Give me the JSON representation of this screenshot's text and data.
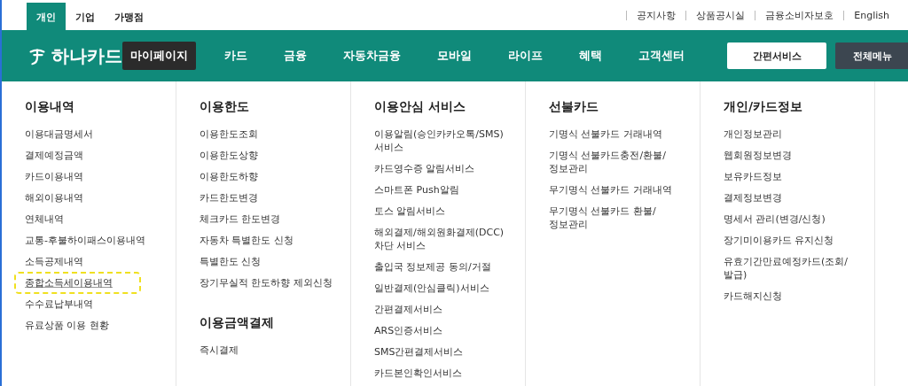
{
  "top_tabs": [
    {
      "label": "개인",
      "selected": true
    },
    {
      "label": "기업",
      "selected": false
    },
    {
      "label": "가맹점",
      "selected": false
    }
  ],
  "util_links": [
    "공지사항",
    "상품공시실",
    "금융소비자보호",
    "English"
  ],
  "logo": {
    "text": "하나카드"
  },
  "nav": [
    {
      "label": "마이페이지",
      "selected": true
    },
    {
      "label": "카드",
      "selected": false
    },
    {
      "label": "금융",
      "selected": false
    },
    {
      "label": "자동차금융",
      "selected": false
    },
    {
      "label": "모바일",
      "selected": false
    },
    {
      "label": "라이프",
      "selected": false
    },
    {
      "label": "혜택",
      "selected": false
    },
    {
      "label": "고객센터",
      "selected": false
    }
  ],
  "nav_buttons": [
    {
      "label": "간편서비스",
      "kind": "light"
    },
    {
      "label": "전체메뉴",
      "kind": "dark"
    }
  ],
  "columns": [
    {
      "sections": [
        {
          "title": "이용내역",
          "items": [
            {
              "label": "이용대금명세서",
              "highlighted": false
            },
            {
              "label": "결제예정금액",
              "highlighted": false
            },
            {
              "label": "카드이용내역",
              "highlighted": false
            },
            {
              "label": "해외이용내역",
              "highlighted": false
            },
            {
              "label": "연체내역",
              "highlighted": false
            },
            {
              "label": "교통-후불하이패스이용내역",
              "highlighted": false
            },
            {
              "label": "소득공제내역",
              "highlighted": false
            },
            {
              "label": "종합소득세이용내역",
              "highlighted": true
            },
            {
              "label": "수수료납부내역",
              "highlighted": false
            },
            {
              "label": "유료상품 이용 현황",
              "highlighted": false
            }
          ]
        }
      ]
    },
    {
      "sections": [
        {
          "title": "이용한도",
          "items": [
            {
              "label": "이용한도조회",
              "highlighted": false
            },
            {
              "label": "이용한도상향",
              "highlighted": false
            },
            {
              "label": "이용한도하향",
              "highlighted": false
            },
            {
              "label": "카드한도변경",
              "highlighted": false
            },
            {
              "label": "체크카드 한도변경",
              "highlighted": false
            },
            {
              "label": "자동차 특별한도 신청",
              "highlighted": false
            },
            {
              "label": "특별한도 신청",
              "highlighted": false
            },
            {
              "label": "장기무실적 한도하향 제외신청",
              "highlighted": false
            }
          ]
        },
        {
          "title": "이용금액결제",
          "items": [
            {
              "label": "즉시결제",
              "highlighted": false
            }
          ]
        }
      ]
    },
    {
      "sections": [
        {
          "title": "이용안심 서비스",
          "items": [
            {
              "label": "이용알림(승인카카오톡/SMS) 서비스",
              "highlighted": false
            },
            {
              "label": "카드영수증 알림서비스",
              "highlighted": false
            },
            {
              "label": "스마트폰 Push알림",
              "highlighted": false
            },
            {
              "label": "토스 알림서비스",
              "highlighted": false
            },
            {
              "label": "해외결제/해외원화결제(DCC) 차단 서비스",
              "highlighted": false
            },
            {
              "label": "출입국 정보제공 동의/거절",
              "highlighted": false
            },
            {
              "label": "일반결제(안심클릭)서비스",
              "highlighted": false
            },
            {
              "label": "간편결제서비스",
              "highlighted": false
            },
            {
              "label": "ARS인증서비스",
              "highlighted": false
            },
            {
              "label": "SMS간편결제서비스",
              "highlighted": false
            },
            {
              "label": "카드본인확인서비스",
              "highlighted": false
            }
          ]
        }
      ]
    },
    {
      "sections": [
        {
          "title": "선불카드",
          "items": [
            {
              "label": "기명식 선불카드 거래내역",
              "highlighted": false
            },
            {
              "label": "기명식 선불카드충전/환불/ 정보관리",
              "highlighted": false
            },
            {
              "label": "무기명식 선불카드 거래내역",
              "highlighted": false
            },
            {
              "label": "무기명식 선불카드 환불/ 정보관리",
              "highlighted": false
            }
          ]
        }
      ]
    },
    {
      "sections": [
        {
          "title": "개인/카드정보",
          "items": [
            {
              "label": "개인정보관리",
              "highlighted": false
            },
            {
              "label": "웹회원정보변경",
              "highlighted": false
            },
            {
              "label": "보유카드정보",
              "highlighted": false
            },
            {
              "label": "결제정보변경",
              "highlighted": false
            },
            {
              "label": "명세서 관리(변경/신청)",
              "highlighted": false
            },
            {
              "label": "장기미이용카드 유지신청",
              "highlighted": false
            },
            {
              "label": "유효기간만료예정카드(조회/ 발급)",
              "highlighted": false
            },
            {
              "label": "카드해지신청",
              "highlighted": false
            }
          ]
        }
      ]
    }
  ]
}
